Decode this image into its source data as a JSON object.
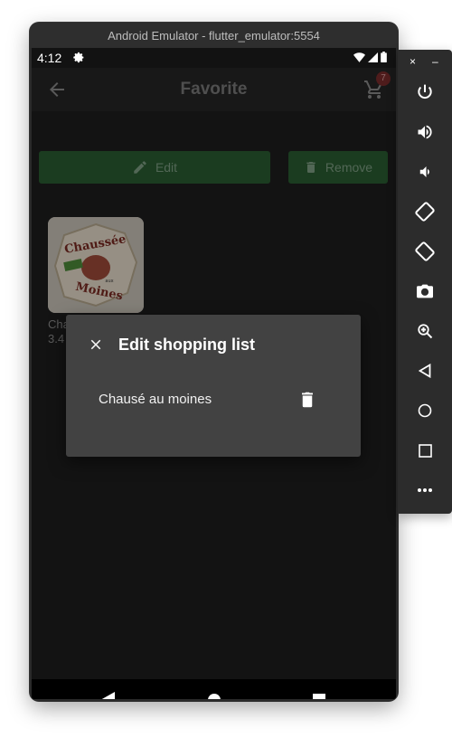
{
  "window": {
    "title": "Android Emulator - flutter_emulator:5554"
  },
  "status_bar": {
    "time": "4:12"
  },
  "app_bar": {
    "title": "Favorite",
    "cart_count": "7"
  },
  "actions": {
    "edit_label": "Edit",
    "remove_label": "Remove"
  },
  "product": {
    "name_partial": "Cha",
    "price_partial": "3.4",
    "image_text_top": "Chaussée",
    "image_text_bottom": "Moines",
    "image_text_small": "aux"
  },
  "dialog": {
    "title": "Edit shopping list",
    "item_label": "Chausé au moines"
  },
  "emulator_panel": {
    "close": "×",
    "minimize": "–"
  }
}
